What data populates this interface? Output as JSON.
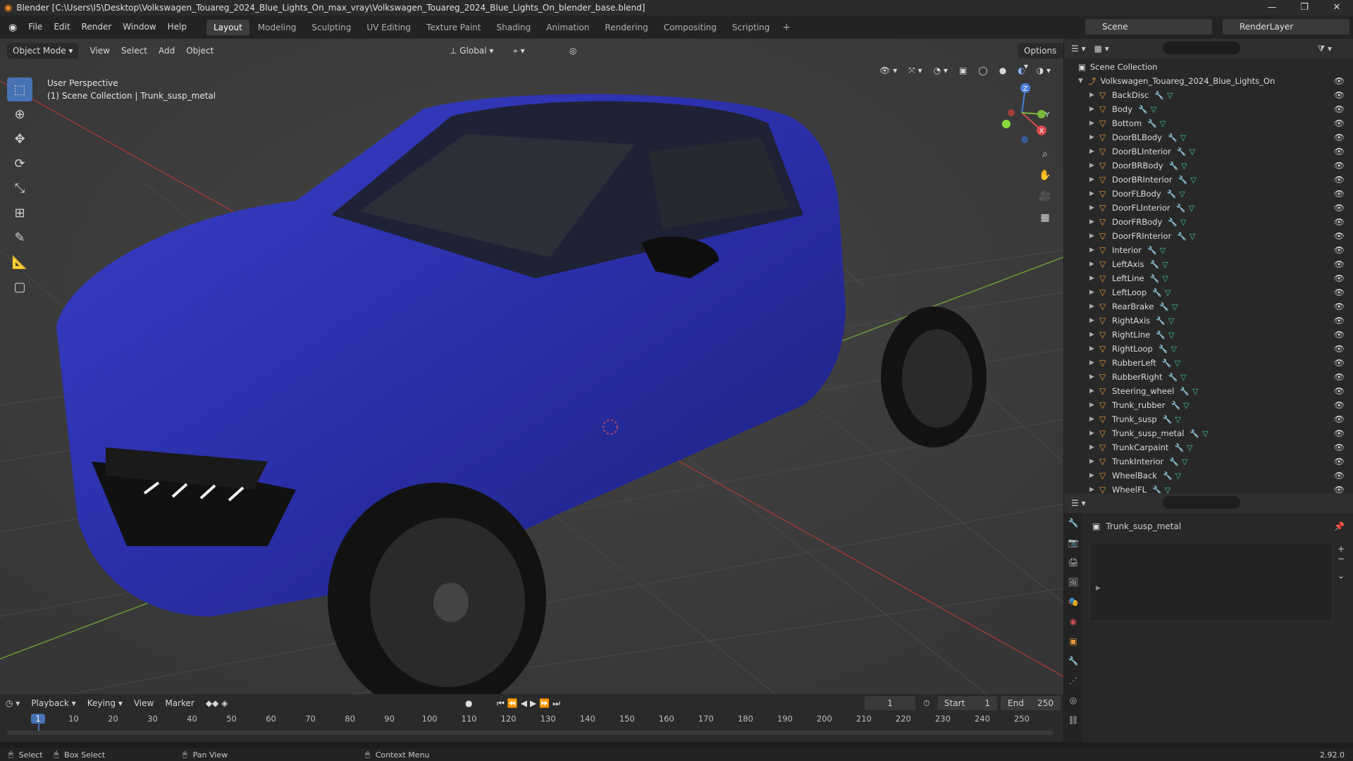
{
  "titlebar": {
    "title": "Blender [C:\\Users\\I5\\Desktop\\Volkswagen_Touareg_2024_Blue_Lights_On_max_vray\\Volkswagen_Touareg_2024_Blue_Lights_On_blender_base.blend]",
    "minimize": "—",
    "maximize": "❐",
    "close": "✕"
  },
  "menu": [
    "File",
    "Edit",
    "Render",
    "Window",
    "Help"
  ],
  "workspaces": [
    "Layout",
    "Modeling",
    "Sculpting",
    "UV Editing",
    "Texture Paint",
    "Shading",
    "Animation",
    "Rendering",
    "Compositing",
    "Scripting"
  ],
  "active_workspace": "Layout",
  "scene": "Scene",
  "render_layer": "RenderLayer",
  "viewport": {
    "mode": "Object Mode",
    "header_menus": [
      "View",
      "Select",
      "Add",
      "Object"
    ],
    "transform_orientation": "Global",
    "options_label": "Options",
    "perspective_label": "User Perspective",
    "context_label": "(1) Scene Collection | Trunk_susp_metal",
    "gizmo": {
      "x": "X",
      "y": "Y",
      "z": "Z"
    }
  },
  "outliner": {
    "root": "Scene Collection",
    "collection": "Volkswagen_Touareg_2024_Blue_Lights_On",
    "objects": [
      "BackDisc",
      "Body",
      "Bottom",
      "DoorBLBody",
      "DoorBLInterior",
      "DoorBRBody",
      "DoorBRInterior",
      "DoorFLBody",
      "DoorFLInterior",
      "DoorFRBody",
      "DoorFRInterior",
      "Interior",
      "LeftAxis",
      "LeftLine",
      "LeftLoop",
      "RearBrake",
      "RightAxis",
      "RightLine",
      "RightLoop",
      "RubberLeft",
      "RubberRight",
      "Steering_wheel",
      "Trunk_rubber",
      "Trunk_susp",
      "Trunk_susp_metal",
      "TrunkCarpaint",
      "TrunkInterior",
      "WheelBack",
      "WheelFL"
    ],
    "selected": "Trunk_susp_metal"
  },
  "properties": {
    "object_name": "Trunk_susp_metal"
  },
  "timeline": {
    "menus": [
      "Playback",
      "Keying",
      "View",
      "Marker"
    ],
    "current_frame": "1",
    "start_label": "Start",
    "start": "1",
    "end_label": "End",
    "end": "250",
    "ticks": [
      "1",
      "10",
      "20",
      "30",
      "40",
      "50",
      "60",
      "70",
      "80",
      "90",
      "100",
      "110",
      "120",
      "130",
      "140",
      "150",
      "160",
      "170",
      "180",
      "190",
      "200",
      "210",
      "220",
      "230",
      "240",
      "250"
    ]
  },
  "statusbar": {
    "select": "Select",
    "box_select": "Box Select",
    "pan_view": "Pan View",
    "context_menu": "Context Menu",
    "version": "2.92.0"
  },
  "colors": {
    "car_body": "#2a2fa8",
    "selection": "#4772b3",
    "object_icon": "#e59a3a"
  }
}
